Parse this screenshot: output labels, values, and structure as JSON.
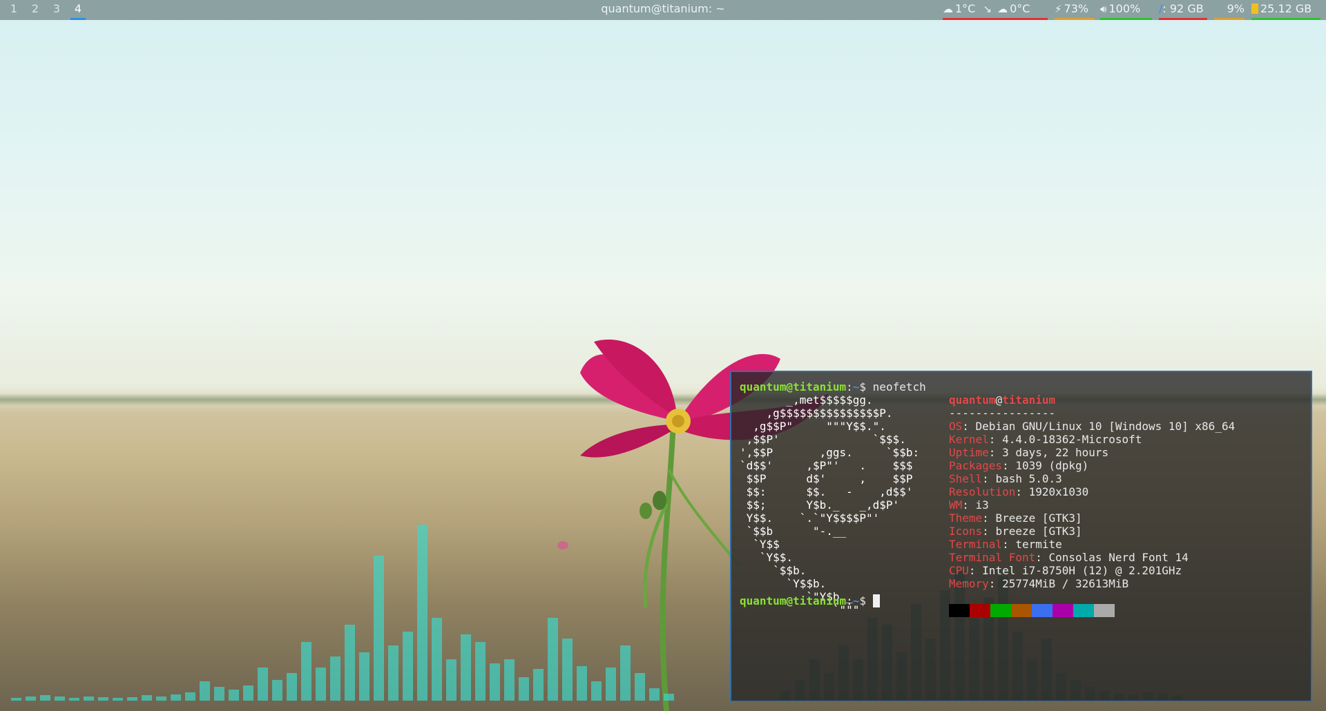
{
  "workspaces": [
    {
      "label": "1",
      "active": false
    },
    {
      "label": "2",
      "active": false
    },
    {
      "label": "3",
      "active": false
    },
    {
      "label": "4",
      "active": true
    }
  ],
  "window_title": "quantum@titanium: ~",
  "status": {
    "weather1": {
      "icon": "cloud-icon",
      "value": "1°C",
      "underline": "#e03030"
    },
    "weather2": {
      "icon": "cloud-icon",
      "value": "0°C",
      "underline": "#e03030"
    },
    "battery": {
      "icon": "battery-charging-icon",
      "value": "73%",
      "underline": "#e0a030"
    },
    "volume": {
      "icon": "speaker-icon",
      "value": "100%",
      "underline": "#30c030"
    },
    "disk": {
      "icon": "root-disk-icon",
      "glyph": "/",
      "value": ": 92 GB",
      "underline": "#e03030"
    },
    "cpu": {
      "value": "9%",
      "underline": "#e0a030"
    },
    "memory": {
      "icon": "memory-icon",
      "value": "25.12 GB",
      "underline": "#30c030"
    }
  },
  "colors": {
    "accent": "#2f6fa8",
    "prompt_user": "#8ae234",
    "prompt_path": "#3b8eea",
    "info_key": "#e34848",
    "visualizer": "#3fd6c8"
  },
  "terminal": {
    "prompt_user": "quantum@titanium",
    "prompt_sep": ":",
    "prompt_path": "~",
    "prompt_dollar": "$ ",
    "command": "neofetch",
    "ascii_logo": "       _,met$$$$$gg.\n    ,g$$$$$$$$$$$$$$$P.\n  ,g$$P\"     \"\"\"Y$$.\".\n ,$$P'              `$$$.\n',$$P       ,ggs.     `$$b:\n`d$$'     ,$P\"'   .    $$$\n $$P      d$'     ,    $$P\n $$:      $$.   -    ,d$$'\n $$;      Y$b._   _,d$P'\n Y$$.    `.`\"Y$$$$P\"'\n `$$b      \"-.__\n  `Y$$\n   `Y$$.\n     `$$b.\n       `Y$$b.\n          `\"Y$b._\n              `\"\"\"",
    "header_user": "quantum",
    "header_at": "@",
    "header_host": "titanium",
    "separator": "----------------",
    "info": [
      {
        "key": "OS",
        "value": "Debian GNU/Linux 10 [Windows 10] x86_64"
      },
      {
        "key": "Kernel",
        "value": "4.4.0-18362-Microsoft"
      },
      {
        "key": "Uptime",
        "value": "3 days, 22 hours"
      },
      {
        "key": "Packages",
        "value": "1039 (dpkg)"
      },
      {
        "key": "Shell",
        "value": "bash 5.0.3"
      },
      {
        "key": "Resolution",
        "value": "1920x1030"
      },
      {
        "key": "WM",
        "value": "i3"
      },
      {
        "key": "Theme",
        "value": "Breeze [GTK3]"
      },
      {
        "key": "Icons",
        "value": "breeze [GTK3]"
      },
      {
        "key": "Terminal",
        "value": "termite"
      },
      {
        "key": "Terminal Font",
        "value": "Consolas Nerd Font 14"
      },
      {
        "key": "CPU",
        "value": "Intel i7-8750H (12) @ 2.201GHz"
      },
      {
        "key": "Memory",
        "value": "25774MiB / 32613MiB"
      }
    ],
    "palette": [
      "#000000",
      "#aa0000",
      "#00aa00",
      "#aa5500",
      "#3b6ff0",
      "#aa00aa",
      "#00aaaa",
      "#aaaaaa"
    ]
  }
}
